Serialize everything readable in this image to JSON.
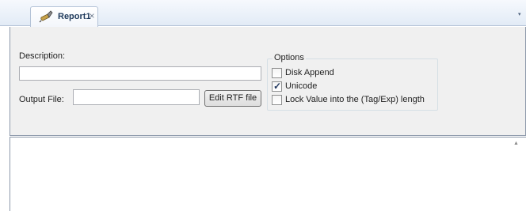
{
  "tab": {
    "icon": "report-pen-icon",
    "label": "Report1",
    "close_glyph": "×",
    "dropdown_glyph": "▾"
  },
  "form": {
    "description_label": "Description:",
    "description_value": "",
    "output_file_label": "Output File:",
    "output_file_value": "",
    "edit_rtf_button": "Edit RTF file"
  },
  "options": {
    "title": "Options",
    "items": [
      {
        "label": "Disk Append",
        "checked": false
      },
      {
        "label": "Unicode",
        "checked": true
      },
      {
        "label": "Lock Value into the (Tag/Exp) length",
        "checked": false
      }
    ]
  },
  "editor": {
    "content": "",
    "scroll_up_glyph": "▲"
  }
}
